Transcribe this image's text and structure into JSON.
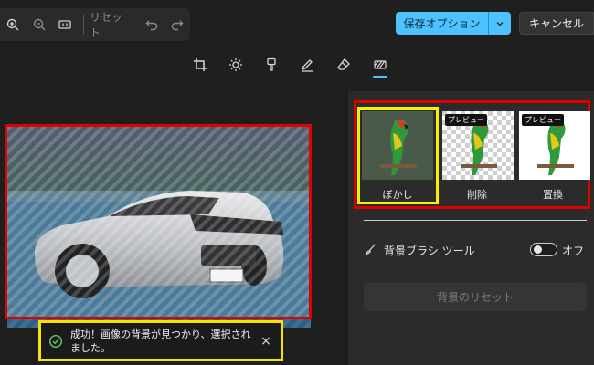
{
  "toolbar": {
    "zoom_in_icon": "zoom-in-icon",
    "zoom_out_icon": "zoom-out-icon",
    "fit_icon": "fit-icon",
    "reset_label": "リセット",
    "undo_icon": "undo-icon",
    "redo_icon": "redo-icon"
  },
  "header": {
    "save_options_label": "保存オプション",
    "cancel_label": "キャンセル"
  },
  "tools": [
    "crop-icon",
    "adjust-icon",
    "filter-icon",
    "markup-icon",
    "erase-icon",
    "background-icon"
  ],
  "toast": {
    "message": "成功！画像の背景が見つかり、選択されました。",
    "close_label": "×"
  },
  "panel": {
    "presets": [
      {
        "label": "ぼかし",
        "badge": ""
      },
      {
        "label": "削除",
        "badge": "プレビュー"
      },
      {
        "label": "置換",
        "badge": "プレビュー"
      }
    ],
    "brush_label": "背景ブラシ ツール",
    "toggle_state": "オフ",
    "toggle_on": false,
    "reset_label": "背景のリセット"
  },
  "colors": {
    "accent": "#4cc2ff",
    "annotation_red": "#e00000",
    "annotation_yellow": "#f5ef00"
  }
}
